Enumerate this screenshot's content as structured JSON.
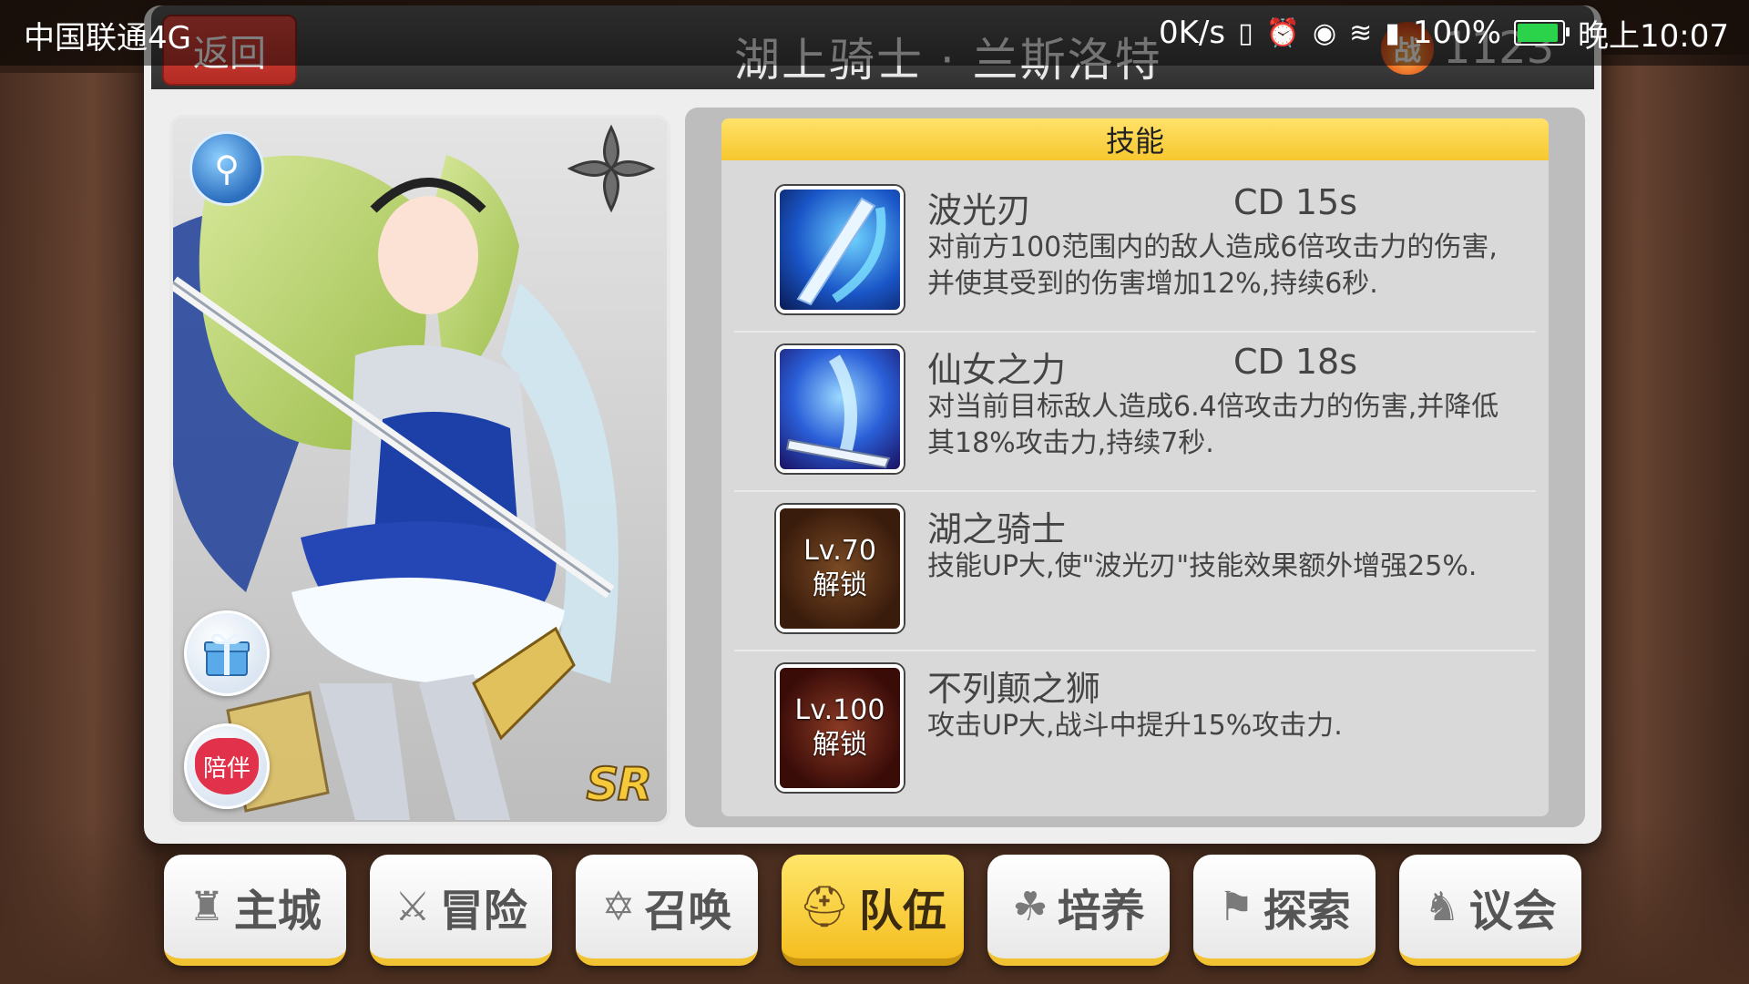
{
  "status_bar": {
    "carrier": "中国联通4G",
    "net_speed": "0K/s",
    "battery": "100%",
    "battery_level": 1.0,
    "time": "晚上10:07"
  },
  "header": {
    "back_label": "返回",
    "title": "湖上骑士 · 兰斯洛特",
    "power_badge": "战",
    "power_value": "1123"
  },
  "card": {
    "gift_icon": "gift-icon",
    "heart_label": "陪伴",
    "rarity": "SR"
  },
  "skills": {
    "heading": "技能",
    "items": [
      {
        "name": "波光刃",
        "cd": "CD  15s",
        "desc": "对前方100范围内的敌人造成6倍攻击力的伤害,并使其受到的伤害增加12%,持续6秒.",
        "icon": "sword-wave-icon"
      },
      {
        "name": "仙女之力",
        "cd": "CD  18s",
        "desc": "对当前目标敌人造成6.4倍攻击力的伤害,并降低其18%攻击力,持续7秒.",
        "icon": "fairy-sword-icon"
      },
      {
        "name": "湖之骑士",
        "cd": "",
        "desc": "技能UP大,使\"波光刃\"技能效果额外增强25%.",
        "lock_level": "Lv.70",
        "lock_text": "解锁"
      },
      {
        "name": "不列颠之狮",
        "cd": "",
        "desc": "攻击UP大,战斗中提升15%攻击力.",
        "lock_level": "Lv.100",
        "lock_text": "解锁"
      }
    ]
  },
  "nav": {
    "items": [
      {
        "label": "主城",
        "icon": "castle-icon",
        "glyph": "♜"
      },
      {
        "label": "冒险",
        "icon": "crossed-swords-icon",
        "glyph": "⚔"
      },
      {
        "label": "召唤",
        "icon": "summon-hexagram-icon",
        "glyph": "✡"
      },
      {
        "label": "队伍",
        "icon": "team-helmet-icon",
        "glyph": "⛑"
      },
      {
        "label": "培养",
        "icon": "training-icon",
        "glyph": "☘"
      },
      {
        "label": "探索",
        "icon": "explore-icon",
        "glyph": "⚑"
      },
      {
        "label": "议会",
        "icon": "council-dragon-icon",
        "glyph": "♞"
      }
    ],
    "active": "队伍"
  }
}
